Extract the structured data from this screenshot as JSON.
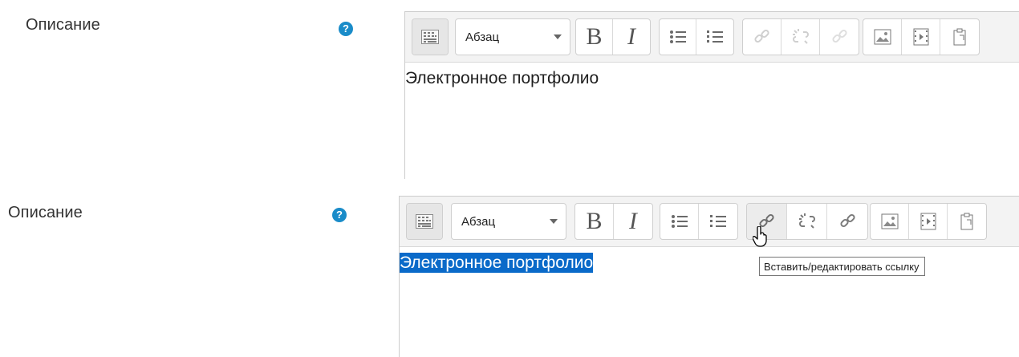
{
  "colors": {
    "help_icon": "#1a8cc9",
    "selection": "#0a6ac9",
    "toolbar_bg": "#f3f3f3"
  },
  "panels": [
    {
      "label": "Описание",
      "help_icon": "question-circle-icon",
      "format_select": {
        "value": "Абзац"
      },
      "buttons": {
        "bold": "B",
        "italic": "I"
      },
      "content_text": "Электронное портфолио",
      "link_state": "disabled",
      "text_selected": false
    },
    {
      "label": "Описание",
      "help_icon": "question-circle-icon",
      "format_select": {
        "value": "Абзац"
      },
      "buttons": {
        "bold": "B",
        "italic": "I"
      },
      "content_text": "Электронное портфолио",
      "link_state": "enabled",
      "text_selected": true,
      "tooltip": "Вставить/редактировать ссылку",
      "cursor": "hand-pointer-icon"
    }
  ]
}
